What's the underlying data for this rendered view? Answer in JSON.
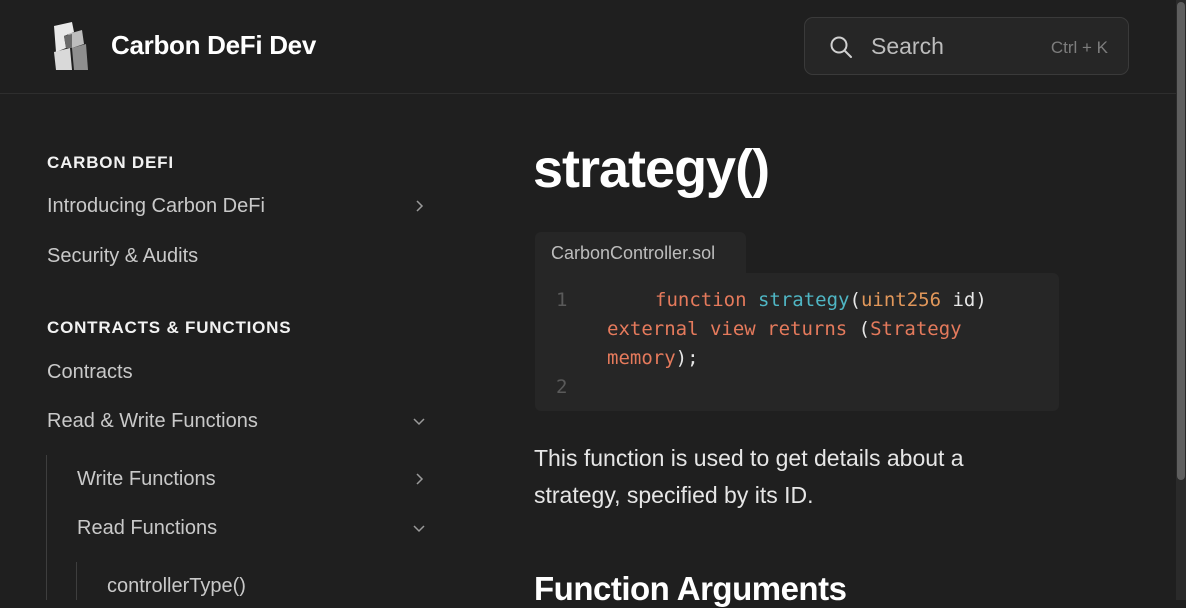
{
  "header": {
    "site_title": "Carbon DeFi Dev",
    "logo_icon": "carbon-logo",
    "search": {
      "placeholder": "Search",
      "shortcut": "Ctrl + K",
      "icon": "search-icon"
    }
  },
  "sidebar": {
    "sections": [
      {
        "title": "CARBON DEFI",
        "items": [
          {
            "label": "Introducing Carbon DeFi",
            "chevron": "right"
          },
          {
            "label": "Security & Audits"
          }
        ]
      },
      {
        "title": "CONTRACTS & FUNCTIONS",
        "items": [
          {
            "label": "Contracts"
          },
          {
            "label": "Read & Write Functions",
            "chevron": "down"
          }
        ]
      }
    ],
    "sub_items": [
      {
        "label": "Write Functions",
        "chevron": "right"
      },
      {
        "label": "Read Functions",
        "chevron": "down"
      }
    ],
    "sub_sub_items": [
      {
        "label": "controllerType()"
      }
    ]
  },
  "main": {
    "title": "strategy()",
    "code": {
      "filename": "CarbonController.sol",
      "line_numbers": [
        "1",
        "2"
      ],
      "tokens": {
        "function_kw": "function",
        "function_name": "strategy",
        "open_paren": "(",
        "param_type": "uint256",
        "param_name": " id)",
        "modifiers": "external view returns",
        "paren2": " (",
        "return_type": "Strategy",
        "memory_kw": "memory",
        "end": ");"
      }
    },
    "description": "This function is used to get details about a strategy, specified by its ID.",
    "section_heading": "Function Arguments"
  },
  "colors": {
    "background": "#1f1f1f",
    "code_bg": "#262626",
    "keyword": "#e57a5c",
    "function_name": "#4fb6c4",
    "type": "#e1975a"
  }
}
